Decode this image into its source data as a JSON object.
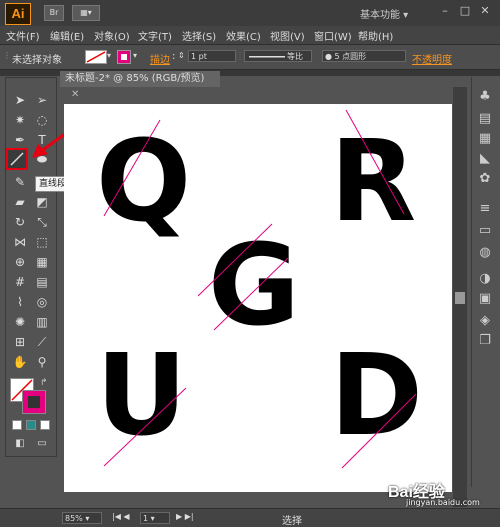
{
  "app": {
    "logo": "Ai",
    "br_button": "Br",
    "workspace": "基本功能",
    "window_controls": [
      "minimize-icon",
      "restore-icon",
      "close-icon"
    ]
  },
  "menu": [
    "文件(F)",
    "编辑(E)",
    "对象(O)",
    "文字(T)",
    "选择(S)",
    "效果(C)",
    "视图(V)",
    "窗口(W)",
    "帮助(H)"
  ],
  "control_bar": {
    "selection_status": "未选择对象",
    "stroke_label": "描边",
    "stroke_weight": "1 pt",
    "profile": "等比",
    "brush": "5 点圆形",
    "opacity_label": "不透明度",
    "colors": {
      "fill_indicator": "#e4007f",
      "accent_link": "#f7941d"
    }
  },
  "document": {
    "tab_title": "未标题-2* @ 85% (RGB/预览)",
    "artboard_letters": {
      "top_left": "Q",
      "top_right": "R",
      "center": "G",
      "bottom_left": "U",
      "bottom_right": "D"
    },
    "line_color": "#e4007f"
  },
  "tooltip": "直线段工具 (\\)",
  "status_bar": {
    "zoom": "85%",
    "page": "1",
    "mode": "选择"
  },
  "watermark": {
    "text": "Bai",
    "suffix": "经验",
    "url": "jingyan.baidu.com"
  }
}
